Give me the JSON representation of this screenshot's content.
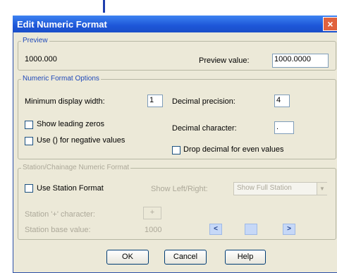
{
  "window": {
    "title": "Edit Numeric Format",
    "close_glyph": "×"
  },
  "preview": {
    "legend": "Preview",
    "sample_text": "1000.000",
    "value_label": "Preview value:",
    "value": "1000.0000"
  },
  "options": {
    "legend": "Numeric Format Options",
    "min_width_label": "Minimum display width:",
    "min_width_value": "1",
    "decimal_precision_label": "Decimal precision:",
    "decimal_precision_value": "4",
    "show_leading_zeros_label": "Show leading zeros",
    "use_parens_label": "Use () for negative values",
    "decimal_character_label": "Decimal character:",
    "decimal_character_value": ".",
    "drop_decimal_label": "Drop decimal for even values"
  },
  "station": {
    "legend": "Station/Chainage Numeric Format",
    "use_station_label": "Use Station Format",
    "show_left_right_label": "Show Left/Right:",
    "show_left_right_value": "Show Full Station",
    "plus_char_label": "Station '+' character:",
    "plus_char_value": "+",
    "base_value_label": "Station base value:",
    "base_value": "1000",
    "scroll_left_glyph": "<",
    "scroll_right_glyph": ">",
    "dropdown_glyph": "▼"
  },
  "buttons": {
    "ok": "OK",
    "cancel": "Cancel",
    "help": "Help"
  },
  "colors": {
    "title_bar": "#1d56d8",
    "legend_text": "#1f49b9",
    "dialog_bg": "#ece9d8",
    "close_button": "#e0623e"
  }
}
